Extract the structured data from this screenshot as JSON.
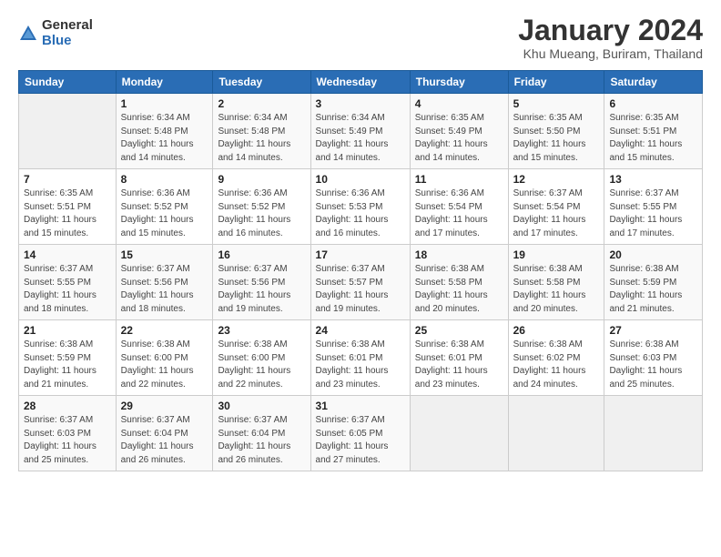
{
  "header": {
    "logo_general": "General",
    "logo_blue": "Blue",
    "month_title": "January 2024",
    "location": "Khu Mueang, Buriram, Thailand"
  },
  "days_of_week": [
    "Sunday",
    "Monday",
    "Tuesday",
    "Wednesday",
    "Thursday",
    "Friday",
    "Saturday"
  ],
  "weeks": [
    [
      {
        "day": "",
        "info": ""
      },
      {
        "day": "1",
        "info": "Sunrise: 6:34 AM\nSunset: 5:48 PM\nDaylight: 11 hours\nand 14 minutes."
      },
      {
        "day": "2",
        "info": "Sunrise: 6:34 AM\nSunset: 5:48 PM\nDaylight: 11 hours\nand 14 minutes."
      },
      {
        "day": "3",
        "info": "Sunrise: 6:34 AM\nSunset: 5:49 PM\nDaylight: 11 hours\nand 14 minutes."
      },
      {
        "day": "4",
        "info": "Sunrise: 6:35 AM\nSunset: 5:49 PM\nDaylight: 11 hours\nand 14 minutes."
      },
      {
        "day": "5",
        "info": "Sunrise: 6:35 AM\nSunset: 5:50 PM\nDaylight: 11 hours\nand 15 minutes."
      },
      {
        "day": "6",
        "info": "Sunrise: 6:35 AM\nSunset: 5:51 PM\nDaylight: 11 hours\nand 15 minutes."
      }
    ],
    [
      {
        "day": "7",
        "info": "Sunrise: 6:35 AM\nSunset: 5:51 PM\nDaylight: 11 hours\nand 15 minutes."
      },
      {
        "day": "8",
        "info": "Sunrise: 6:36 AM\nSunset: 5:52 PM\nDaylight: 11 hours\nand 15 minutes."
      },
      {
        "day": "9",
        "info": "Sunrise: 6:36 AM\nSunset: 5:52 PM\nDaylight: 11 hours\nand 16 minutes."
      },
      {
        "day": "10",
        "info": "Sunrise: 6:36 AM\nSunset: 5:53 PM\nDaylight: 11 hours\nand 16 minutes."
      },
      {
        "day": "11",
        "info": "Sunrise: 6:36 AM\nSunset: 5:54 PM\nDaylight: 11 hours\nand 17 minutes."
      },
      {
        "day": "12",
        "info": "Sunrise: 6:37 AM\nSunset: 5:54 PM\nDaylight: 11 hours\nand 17 minutes."
      },
      {
        "day": "13",
        "info": "Sunrise: 6:37 AM\nSunset: 5:55 PM\nDaylight: 11 hours\nand 17 minutes."
      }
    ],
    [
      {
        "day": "14",
        "info": "Sunrise: 6:37 AM\nSunset: 5:55 PM\nDaylight: 11 hours\nand 18 minutes."
      },
      {
        "day": "15",
        "info": "Sunrise: 6:37 AM\nSunset: 5:56 PM\nDaylight: 11 hours\nand 18 minutes."
      },
      {
        "day": "16",
        "info": "Sunrise: 6:37 AM\nSunset: 5:56 PM\nDaylight: 11 hours\nand 19 minutes."
      },
      {
        "day": "17",
        "info": "Sunrise: 6:37 AM\nSunset: 5:57 PM\nDaylight: 11 hours\nand 19 minutes."
      },
      {
        "day": "18",
        "info": "Sunrise: 6:38 AM\nSunset: 5:58 PM\nDaylight: 11 hours\nand 20 minutes."
      },
      {
        "day": "19",
        "info": "Sunrise: 6:38 AM\nSunset: 5:58 PM\nDaylight: 11 hours\nand 20 minutes."
      },
      {
        "day": "20",
        "info": "Sunrise: 6:38 AM\nSunset: 5:59 PM\nDaylight: 11 hours\nand 21 minutes."
      }
    ],
    [
      {
        "day": "21",
        "info": "Sunrise: 6:38 AM\nSunset: 5:59 PM\nDaylight: 11 hours\nand 21 minutes."
      },
      {
        "day": "22",
        "info": "Sunrise: 6:38 AM\nSunset: 6:00 PM\nDaylight: 11 hours\nand 22 minutes."
      },
      {
        "day": "23",
        "info": "Sunrise: 6:38 AM\nSunset: 6:00 PM\nDaylight: 11 hours\nand 22 minutes."
      },
      {
        "day": "24",
        "info": "Sunrise: 6:38 AM\nSunset: 6:01 PM\nDaylight: 11 hours\nand 23 minutes."
      },
      {
        "day": "25",
        "info": "Sunrise: 6:38 AM\nSunset: 6:01 PM\nDaylight: 11 hours\nand 23 minutes."
      },
      {
        "day": "26",
        "info": "Sunrise: 6:38 AM\nSunset: 6:02 PM\nDaylight: 11 hours\nand 24 minutes."
      },
      {
        "day": "27",
        "info": "Sunrise: 6:38 AM\nSunset: 6:03 PM\nDaylight: 11 hours\nand 25 minutes."
      }
    ],
    [
      {
        "day": "28",
        "info": "Sunrise: 6:37 AM\nSunset: 6:03 PM\nDaylight: 11 hours\nand 25 minutes."
      },
      {
        "day": "29",
        "info": "Sunrise: 6:37 AM\nSunset: 6:04 PM\nDaylight: 11 hours\nand 26 minutes."
      },
      {
        "day": "30",
        "info": "Sunrise: 6:37 AM\nSunset: 6:04 PM\nDaylight: 11 hours\nand 26 minutes."
      },
      {
        "day": "31",
        "info": "Sunrise: 6:37 AM\nSunset: 6:05 PM\nDaylight: 11 hours\nand 27 minutes."
      },
      {
        "day": "",
        "info": ""
      },
      {
        "day": "",
        "info": ""
      },
      {
        "day": "",
        "info": ""
      }
    ]
  ]
}
